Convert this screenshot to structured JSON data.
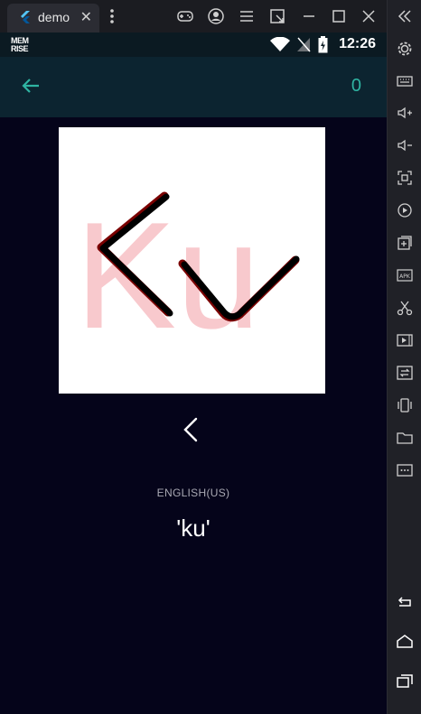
{
  "window": {
    "tab_title": "demo",
    "close_glyph": "✕"
  },
  "status_bar": {
    "logo_line1": "MEM",
    "logo_line2": "RISE",
    "time": "12:26"
  },
  "app_bar": {
    "score": "0"
  },
  "card": {
    "background_letters": "Ku",
    "colors": {
      "ghost_letters": "#f8c9cd",
      "stroke_primary": "#000000",
      "stroke_shadow": "#7a0000"
    }
  },
  "answer": {
    "language": "ENGLISH(US)",
    "text": "'ku'"
  },
  "colors": {
    "screen_bg": "#05041a",
    "appbar_bg": "#0c2430",
    "accent": "#2fb4a2"
  }
}
